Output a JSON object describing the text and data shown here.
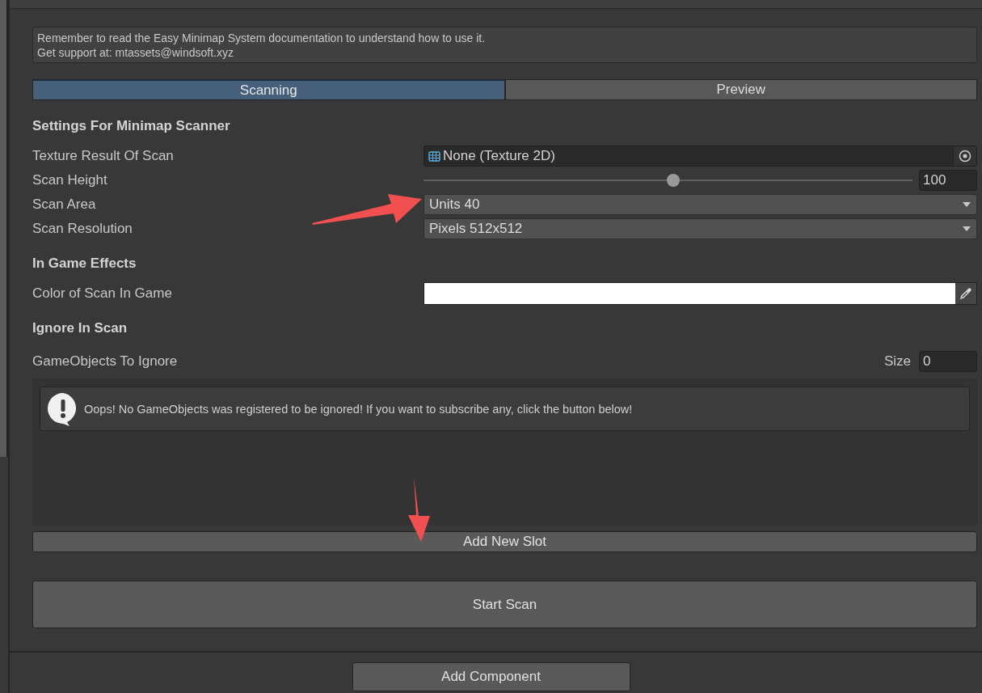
{
  "help_box": {
    "lines": [
      "Remember to read the Easy Minimap System documentation to understand how to use it.",
      "Get support at: mtassets@windsoft.xyz"
    ]
  },
  "tabs": [
    {
      "label": "Scanning",
      "selected": true
    },
    {
      "label": "Preview",
      "selected": false
    }
  ],
  "sections": [
    {
      "title": "Settings For Minimap Scanner",
      "fields": [
        {
          "kind": "object",
          "label": "Texture Result Of Scan",
          "value": "None (Texture 2D)"
        },
        {
          "kind": "slider",
          "label": "Scan Height",
          "value": "100",
          "level": 0.51
        },
        {
          "kind": "dropdown",
          "label": "Scan Area",
          "value": "Units 40"
        },
        {
          "kind": "dropdown",
          "label": "Scan Resolution",
          "value": "Pixels 512x512"
        }
      ]
    },
    {
      "title": "In Game Effects",
      "fields": [
        {
          "kind": "color",
          "label": "Color of Scan In Game",
          "color": "#ffffff"
        }
      ]
    },
    {
      "title": "Ignore In Scan"
    }
  ],
  "ignore_list": {
    "label": "GameObjects To Ignore",
    "size_label": "Size",
    "size_value": "0",
    "message": "Oops! No GameObjects was registered to be ignored! If you want to subscribe any, click the button below!"
  },
  "add_slot_button": "Add New Slot",
  "start_button": "Start Scan",
  "add_component_button": "Add Component"
}
